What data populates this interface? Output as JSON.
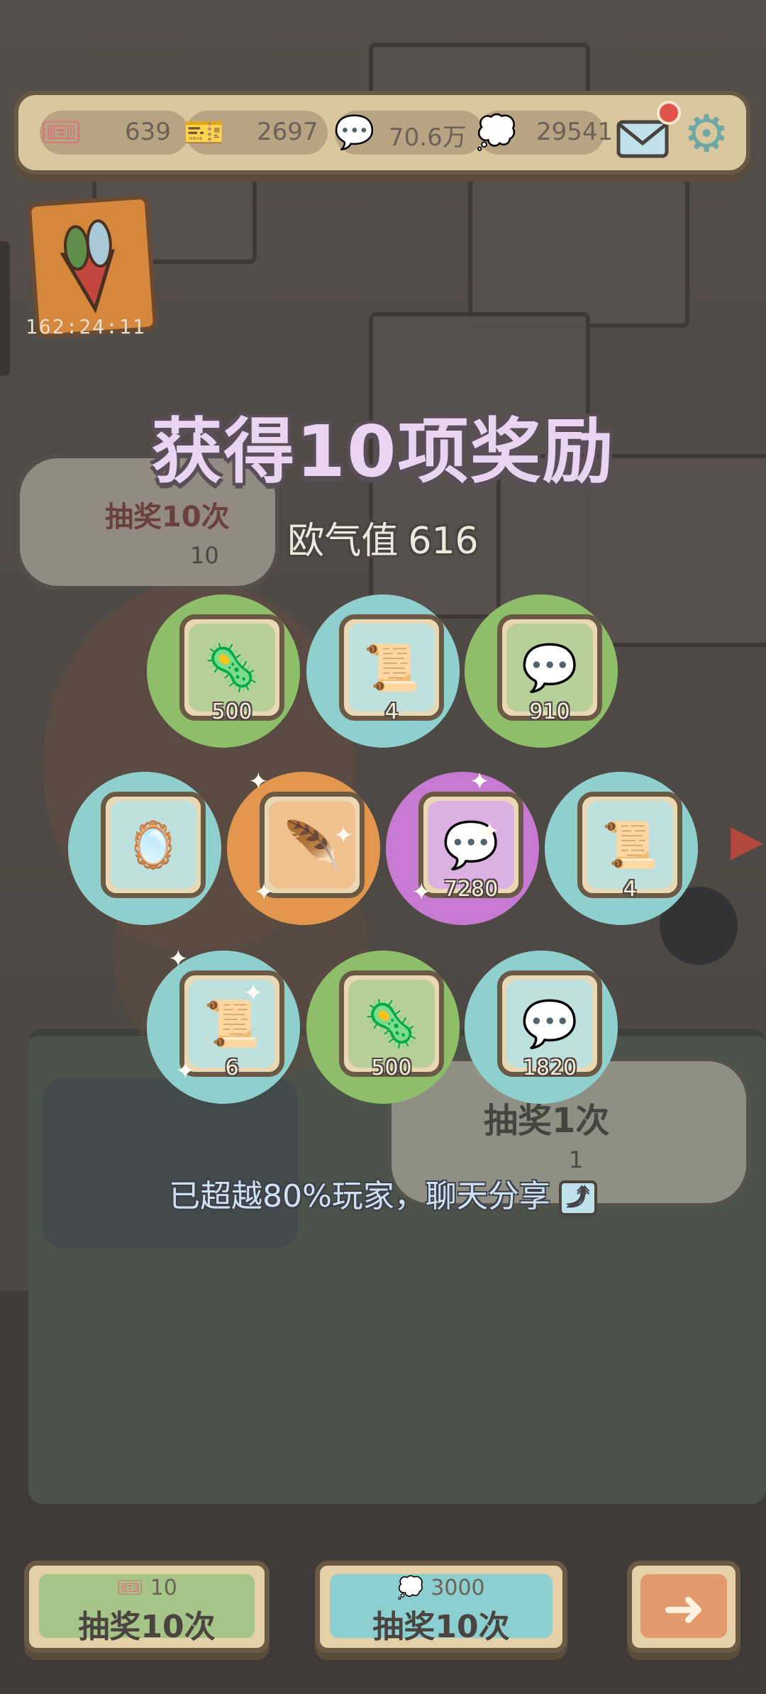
{
  "resources": {
    "ticket_red": {
      "icon": "red-ticket-icon",
      "value": "639"
    },
    "ticket_blue": {
      "icon": "blue-ticket-icon",
      "value": "2697"
    },
    "ghost_gray": {
      "icon": "gray-ghost-icon",
      "value": "70.6万"
    },
    "ghost_white": {
      "icon": "white-ghost-icon",
      "value": "29541"
    }
  },
  "event": {
    "timer": "162:24:11"
  },
  "result": {
    "title": "获得10项奖励",
    "luck_label": "欧气值",
    "luck_value": "616"
  },
  "rewards": [
    {
      "item": "purple-germ-icon",
      "count": "500",
      "bg": "#8fbe6a"
    },
    {
      "item": "scroll-icon",
      "count": "4",
      "bg": "#8fd0cf"
    },
    {
      "item": "gray-ghost-icon",
      "count": "910",
      "bg": "#8fbe6a"
    },
    {
      "item": "mirror-icon",
      "count": "",
      "bg": "#8fd0cf"
    },
    {
      "item": "feather-charm-icon",
      "count": "",
      "bg": "#e3964e"
    },
    {
      "item": "gray-ghost-icon",
      "count": "7280",
      "bg": "#c67ad1"
    },
    {
      "item": "scroll-icon",
      "count": "4",
      "bg": "#8fd0cf"
    },
    {
      "item": "scroll-icon",
      "count": "6",
      "bg": "#8fd0cf"
    },
    {
      "item": "green-germ-icon",
      "count": "500",
      "bg": "#8fbe6a"
    },
    {
      "item": "gray-ghost-icon",
      "count": "1820",
      "bg": "#8fd0cf"
    }
  ],
  "share": {
    "text": "已超越80%玩家，聊天分享"
  },
  "buttons": {
    "draw_ticket": {
      "cost": "10",
      "label": "抽奖10次"
    },
    "draw_ghost": {
      "cost": "3000",
      "label": "抽奖10次"
    }
  },
  "behind": {
    "panel10_label": "抽奖10次",
    "panel10_cost": "10",
    "panel1_label": "抽奖1次",
    "panel1_cost": "1"
  }
}
